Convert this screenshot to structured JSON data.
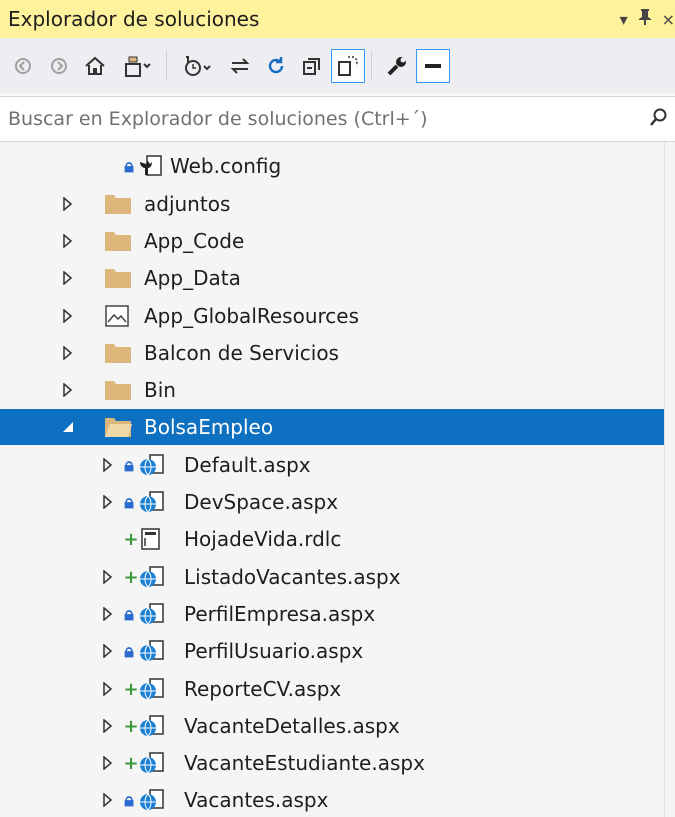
{
  "panel": {
    "title": "Explorador de soluciones",
    "title_icons": [
      "dropdown-arrow-icon",
      "pin-icon",
      "close-icon"
    ]
  },
  "toolbar": {
    "buttons": [
      "back-icon",
      "forward-icon",
      "home-icon",
      "switch-views-icon",
      "pending-changes-filter-icon",
      "sync-active-document-icon",
      "refresh-icon",
      "collapse-all-icon",
      "show-all-files-icon",
      "properties-icon",
      "preview-selected-items-icon"
    ]
  },
  "search": {
    "placeholder": "Buscar en Explorador de soluciones (Ctrl+´)"
  },
  "tree": {
    "items": [
      {
        "label": "Web.config",
        "icon": "config-file-icon",
        "badge": "lock",
        "expander": "none"
      },
      {
        "label": "adjuntos",
        "icon": "folder-icon",
        "badge": "none",
        "expander": "collapsed"
      },
      {
        "label": "App_Code",
        "icon": "folder-icon",
        "badge": "none",
        "expander": "collapsed"
      },
      {
        "label": "App_Data",
        "icon": "folder-icon",
        "badge": "none",
        "expander": "collapsed"
      },
      {
        "label": "App_GlobalResources",
        "icon": "resources-folder-icon",
        "badge": "none",
        "expander": "collapsed"
      },
      {
        "label": "Balcon de Servicios",
        "icon": "folder-icon",
        "badge": "none",
        "expander": "collapsed"
      },
      {
        "label": "Bin",
        "icon": "folder-icon",
        "badge": "none",
        "expander": "collapsed"
      },
      {
        "label": "BolsaEmpleo",
        "icon": "open-folder-icon",
        "badge": "none",
        "expander": "expanded",
        "selected": true
      },
      {
        "label": "Default.aspx",
        "icon": "web-page-icon",
        "badge": "lock",
        "expander": "collapsed"
      },
      {
        "label": "DevSpace.aspx",
        "icon": "web-page-icon",
        "badge": "lock",
        "expander": "collapsed"
      },
      {
        "label": "HojadeVida.rdlc",
        "icon": "report-file-icon",
        "badge": "plus",
        "expander": "none"
      },
      {
        "label": "ListadoVacantes.aspx",
        "icon": "web-page-icon",
        "badge": "plus",
        "expander": "collapsed"
      },
      {
        "label": "PerfilEmpresa.aspx",
        "icon": "web-page-icon",
        "badge": "lock",
        "expander": "collapsed"
      },
      {
        "label": "PerfilUsuario.aspx",
        "icon": "web-page-icon",
        "badge": "lock",
        "expander": "collapsed"
      },
      {
        "label": "ReporteCV.aspx",
        "icon": "web-page-icon",
        "badge": "plus",
        "expander": "collapsed"
      },
      {
        "label": "VacanteDetalles.aspx",
        "icon": "web-page-icon",
        "badge": "plus",
        "expander": "collapsed"
      },
      {
        "label": "VacanteEstudiante.aspx",
        "icon": "web-page-icon",
        "badge": "plus",
        "expander": "collapsed"
      },
      {
        "label": "Vacantes.aspx",
        "icon": "web-page-icon",
        "badge": "lock",
        "expander": "collapsed"
      }
    ]
  },
  "colors": {
    "title_bar": "#fff29d",
    "selection": "#0e70c0",
    "folder": "#dcb67a",
    "web_globe": "#1b7fd4",
    "pending_add": "#3a9a3a",
    "checked_in_lock": "#2a6bd0"
  }
}
